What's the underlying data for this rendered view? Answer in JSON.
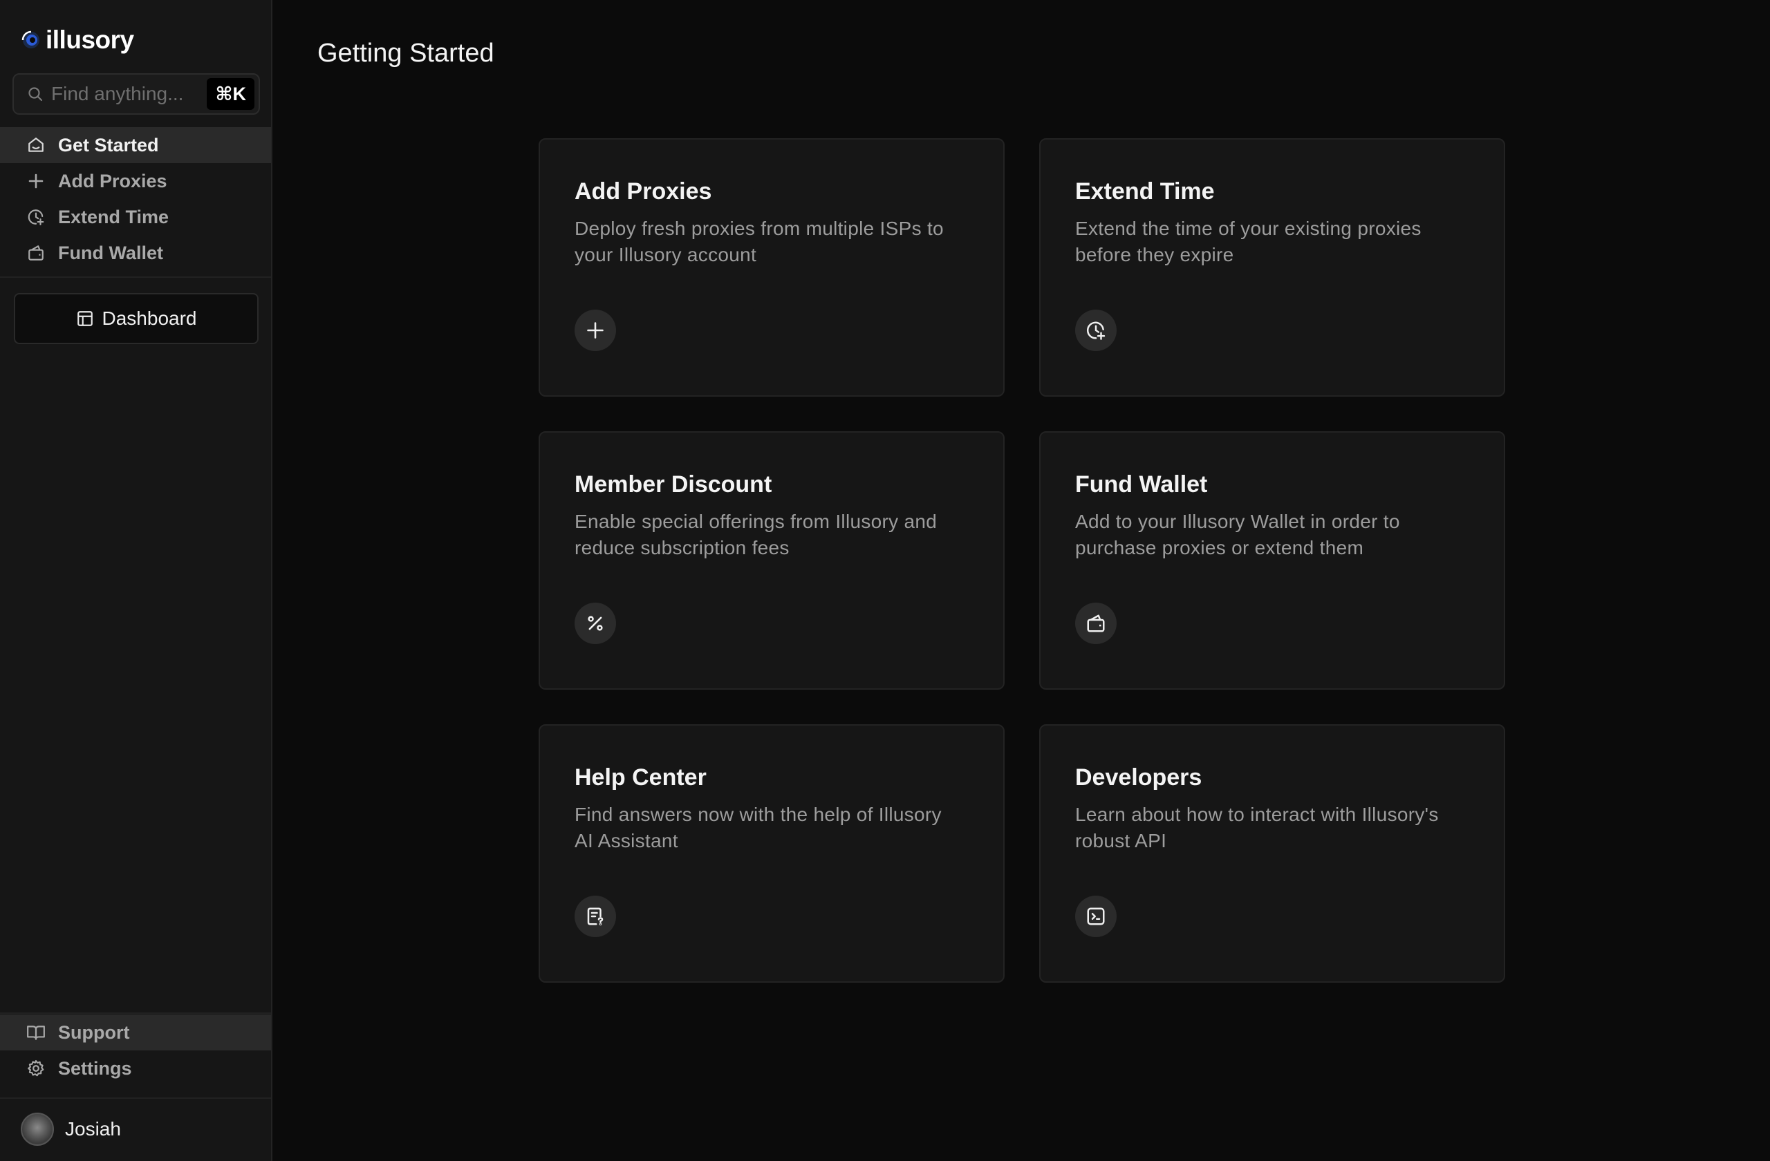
{
  "brand": {
    "name": "illusory"
  },
  "search": {
    "placeholder": "Find anything...",
    "shortcut": "⌘K"
  },
  "sidebar": {
    "items": [
      {
        "label": "Get Started",
        "icon": "home-icon",
        "active": true
      },
      {
        "label": "Add Proxies",
        "icon": "plus-icon",
        "active": false
      },
      {
        "label": "Extend Time",
        "icon": "clock-plus-icon",
        "active": false
      },
      {
        "label": "Fund Wallet",
        "icon": "wallet-icon",
        "active": false
      }
    ],
    "dashboard_label": "Dashboard",
    "bottom_items": [
      {
        "label": "Support",
        "icon": "book-icon"
      },
      {
        "label": "Settings",
        "icon": "gear-icon"
      }
    ],
    "user": {
      "name": "Josiah"
    }
  },
  "main": {
    "title": "Getting Started",
    "cards": [
      {
        "title": "Add Proxies",
        "description": "Deploy fresh proxies from multiple ISPs to your Illusory account",
        "icon": "plus-icon"
      },
      {
        "title": "Extend Time",
        "description": "Extend the time of your existing proxies before they expire",
        "icon": "clock-plus-icon"
      },
      {
        "title": "Member Discount",
        "description": "Enable special offerings from Illusory and reduce subscription fees",
        "icon": "percent-icon"
      },
      {
        "title": "Fund Wallet",
        "description": "Add to your Illusory Wallet in order to purchase proxies or extend them",
        "icon": "wallet-icon"
      },
      {
        "title": "Help Center",
        "description": "Find answers now with the help of Illusory AI Assistant",
        "icon": "help-document-icon"
      },
      {
        "title": "Developers",
        "description": "Learn about how to interact with Illusory's robust API",
        "icon": "terminal-icon"
      }
    ]
  },
  "colors": {
    "background": "#0b0b0b",
    "sidebar": "#161616",
    "card": "#161616",
    "active_item": "#2a2a2a",
    "muted_text": "#9d9d9d"
  }
}
